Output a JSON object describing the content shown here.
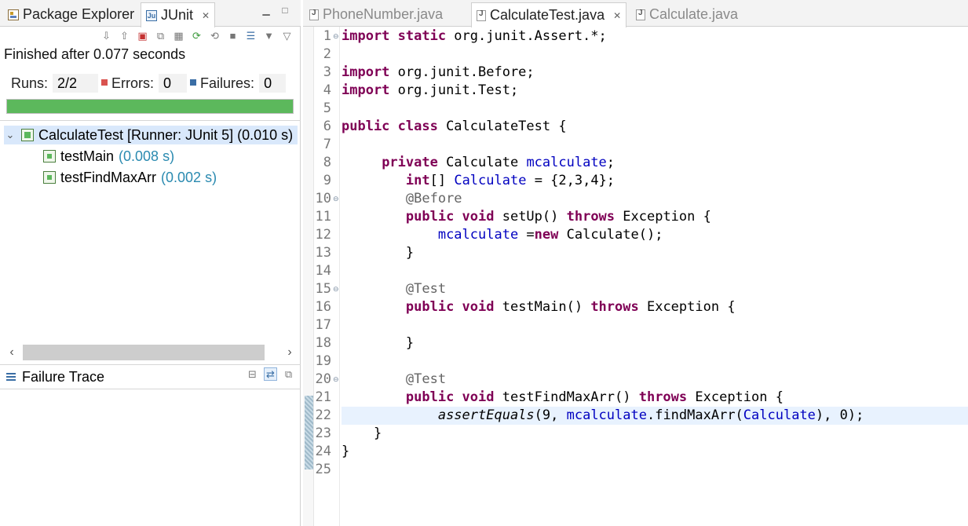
{
  "left_tabs": [
    {
      "label": "Package Explorer",
      "icon": "package-explorer-icon"
    },
    {
      "label": "JUnit",
      "icon": "junit-icon",
      "active": true
    }
  ],
  "junit": {
    "status": "Finished after 0.077 seconds",
    "runs_label": "Runs:",
    "runs_value": "2/2",
    "errors_label": "Errors:",
    "errors_value": "0",
    "failures_label": "Failures:",
    "failures_value": "0",
    "progress_color": "#5cb85c",
    "progress_fraction": 1.0,
    "tree": {
      "suite_label": "CalculateTest [Runner: JUnit 5] (0.010 s)",
      "tests": [
        {
          "name": "testMain",
          "time": "(0.008 s)"
        },
        {
          "name": "testFindMaxArr",
          "time": "(0.002 s)"
        }
      ]
    },
    "failure_trace_label": "Failure Trace"
  },
  "editor_tabs": [
    {
      "label": "PhoneNumber.java",
      "active": false
    },
    {
      "label": "CalculateTest.java",
      "active": true
    },
    {
      "label": "Calculate.java",
      "active": false
    }
  ],
  "editor": {
    "line_numbers": [
      "1",
      "2",
      "3",
      "4",
      "5",
      "6",
      "7",
      "8",
      "9",
      "10",
      "11",
      "12",
      "13",
      "14",
      "15",
      "16",
      "17",
      "18",
      "19",
      "20",
      "21",
      "22",
      "23",
      "24",
      "25"
    ],
    "current_line": 22,
    "code_lines": [
      [
        [
          "kw",
          "import static"
        ],
        [
          "",
          "org.junit.Assert.*;"
        ]
      ],
      [],
      [
        [
          "kw",
          "import"
        ],
        [
          "",
          "org.junit.Before;"
        ]
      ],
      [
        [
          "kw",
          "import"
        ],
        [
          "",
          "org.junit.Test;"
        ]
      ],
      [],
      [
        [
          "kw",
          "public class"
        ],
        [
          "",
          "CalculateTest {"
        ]
      ],
      [],
      [
        [
          "",
          "     "
        ],
        [
          "kw",
          "private"
        ],
        [
          "",
          " Calculate "
        ],
        [
          "fld",
          "mcalculate"
        ],
        [
          "",
          ";"
        ]
      ],
      [
        [
          "",
          "        "
        ],
        [
          "kw",
          "int"
        ],
        [
          "",
          "[] "
        ],
        [
          "fld",
          "Calculate"
        ],
        [
          "",
          " = {2,3,4};"
        ]
      ],
      [
        [
          "",
          "        "
        ],
        [
          "ann",
          "@Before"
        ]
      ],
      [
        [
          "",
          "        "
        ],
        [
          "kw",
          "public void"
        ],
        [
          "",
          " setUp() "
        ],
        [
          "kw",
          "throws"
        ],
        [
          "",
          " Exception {"
        ]
      ],
      [
        [
          "",
          "            "
        ],
        [
          "fld",
          "mcalculate"
        ],
        [
          "",
          " ="
        ],
        [
          "kw",
          "new"
        ],
        [
          "",
          " Calculate();"
        ]
      ],
      [
        [
          "",
          "        }"
        ]
      ],
      [],
      [
        [
          "",
          "        "
        ],
        [
          "ann",
          "@Test"
        ]
      ],
      [
        [
          "",
          "        "
        ],
        [
          "kw",
          "public void"
        ],
        [
          "",
          " testMain() "
        ],
        [
          "kw",
          "throws"
        ],
        [
          "",
          " Exception {"
        ]
      ],
      [],
      [
        [
          "",
          "        }"
        ]
      ],
      [],
      [
        [
          "",
          "        "
        ],
        [
          "ann",
          "@Test"
        ]
      ],
      [
        [
          "",
          "        "
        ],
        [
          "kw",
          "public void"
        ],
        [
          "",
          " testFindMaxArr() "
        ],
        [
          "kw",
          "throws"
        ],
        [
          "",
          " Exception {"
        ]
      ],
      [
        [
          "",
          "            "
        ],
        [
          "ital",
          "assertEquals"
        ],
        [
          "",
          "(9, "
        ],
        [
          "fld",
          "mcalculate"
        ],
        [
          "",
          ".findMaxArr("
        ],
        [
          "fld",
          "Calculate"
        ],
        [
          "",
          "), 0);"
        ]
      ],
      [
        [
          "",
          "    }"
        ]
      ],
      [
        [
          "",
          "}"
        ]
      ],
      []
    ]
  }
}
